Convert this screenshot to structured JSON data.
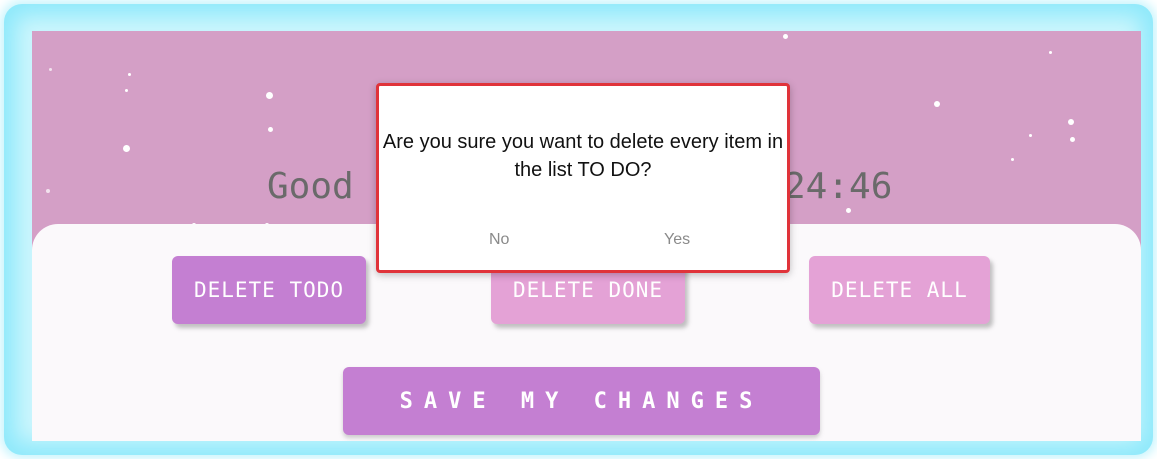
{
  "header": {
    "greeting": "Good",
    "clock": "24:46"
  },
  "actions": {
    "delete_todo_label": "DELETE TODO",
    "delete_done_label": "DELETE DONE",
    "delete_all_label": "DELETE ALL",
    "save_label": "SAVE MY CHANGES"
  },
  "dialog": {
    "message": "Are you sure you want to delete every item in the list TO DO?",
    "no_label": "No",
    "yes_label": "Yes"
  },
  "colors": {
    "hero_background": "#d49fc6",
    "primary_button": "#c47fd2",
    "secondary_button": "#e4a2d6",
    "dialog_border": "#e0333a",
    "frame_glow": "#8ee9fb"
  }
}
